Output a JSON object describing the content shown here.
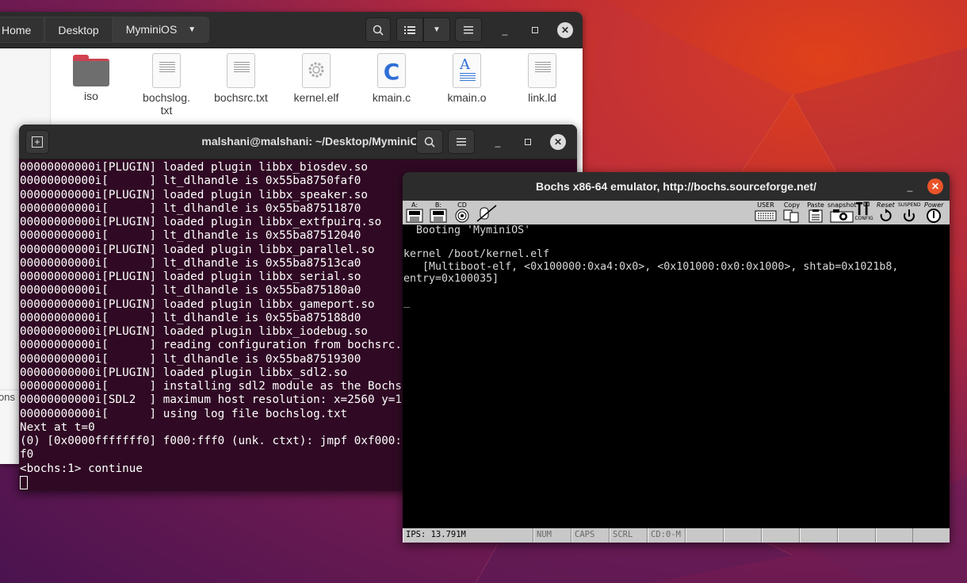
{
  "file_manager": {
    "breadcrumbs": [
      "Home",
      "Desktop",
      "MyminiOS"
    ],
    "files": [
      {
        "name": "iso",
        "type": "folder"
      },
      {
        "name": "bochslog.\ntxt",
        "type": "text"
      },
      {
        "name": "bochsrc.txt",
        "type": "text"
      },
      {
        "name": "kernel.elf",
        "type": "binary"
      },
      {
        "name": "kmain.c",
        "type": "c-source"
      },
      {
        "name": "kmain.o",
        "type": "object"
      },
      {
        "name": "link.ld",
        "type": "text"
      }
    ],
    "sidebar_partial_text": "ons"
  },
  "terminal": {
    "title": "malshani@malshani: ~/Desktop/MyminiOS",
    "lines": [
      "00000000000i[PLUGIN] loaded plugin libbx_biosdev.so",
      "00000000000i[      ] lt_dlhandle is 0x55ba8750faf0",
      "00000000000i[PLUGIN] loaded plugin libbx_speaker.so",
      "00000000000i[      ] lt_dlhandle is 0x55ba87511870",
      "00000000000i[PLUGIN] loaded plugin libbx_extfpuirq.so",
      "00000000000i[      ] lt_dlhandle is 0x55ba87512040",
      "00000000000i[PLUGIN] loaded plugin libbx_parallel.so",
      "00000000000i[      ] lt_dlhandle is 0x55ba87513ca0",
      "00000000000i[PLUGIN] loaded plugin libbx_serial.so",
      "00000000000i[      ] lt_dlhandle is 0x55ba875180a0",
      "00000000000i[PLUGIN] loaded plugin libbx_gameport.so",
      "00000000000i[      ] lt_dlhandle is 0x55ba875188d0",
      "00000000000i[PLUGIN] loaded plugin libbx_iodebug.so",
      "00000000000i[      ] reading configuration from bochsrc.",
      "00000000000i[      ] lt_dlhandle is 0x55ba87519300",
      "00000000000i[PLUGIN] loaded plugin libbx_sdl2.so",
      "00000000000i[      ] installing sdl2 module as the Bochs",
      "00000000000i[SDL2  ] maximum host resolution: x=2560 y=1",
      "00000000000i[      ] using log file bochslog.txt",
      "Next at t=0",
      "(0) [0x0000fffffff0] f000:fff0 (unk. ctxt): jmpf 0xf000:",
      "f0",
      "<bochs:1> continue"
    ]
  },
  "bochs": {
    "title": "Bochs x86-64 emulator, http://bochs.sourceforge.net/",
    "toolbar": {
      "floppy_a": "A:",
      "floppy_b": "B:",
      "cdrom": "CD",
      "user": "USER",
      "copy": "Copy",
      "paste": "Paste",
      "snapshot": "snapshot",
      "config": "CONFIG",
      "reset": "Reset",
      "suspend": "SUSPEND",
      "power": "Power"
    },
    "screen_lines": [
      "  Booting 'MyminiOS'",
      "",
      "kernel /boot/kernel.elf",
      "   [Multiboot-elf, <0x100000:0xa4:0x0>, <0x101000:0x0:0x1000>, shtab=0x1021b8,",
      "entry=0x100035]",
      "",
      "_"
    ],
    "status": [
      "IPS: 13.791M",
      "NUM",
      "CAPS",
      "SCRL",
      "CD:0-M",
      "",
      "",
      "",
      "",
      "",
      ""
    ]
  }
}
